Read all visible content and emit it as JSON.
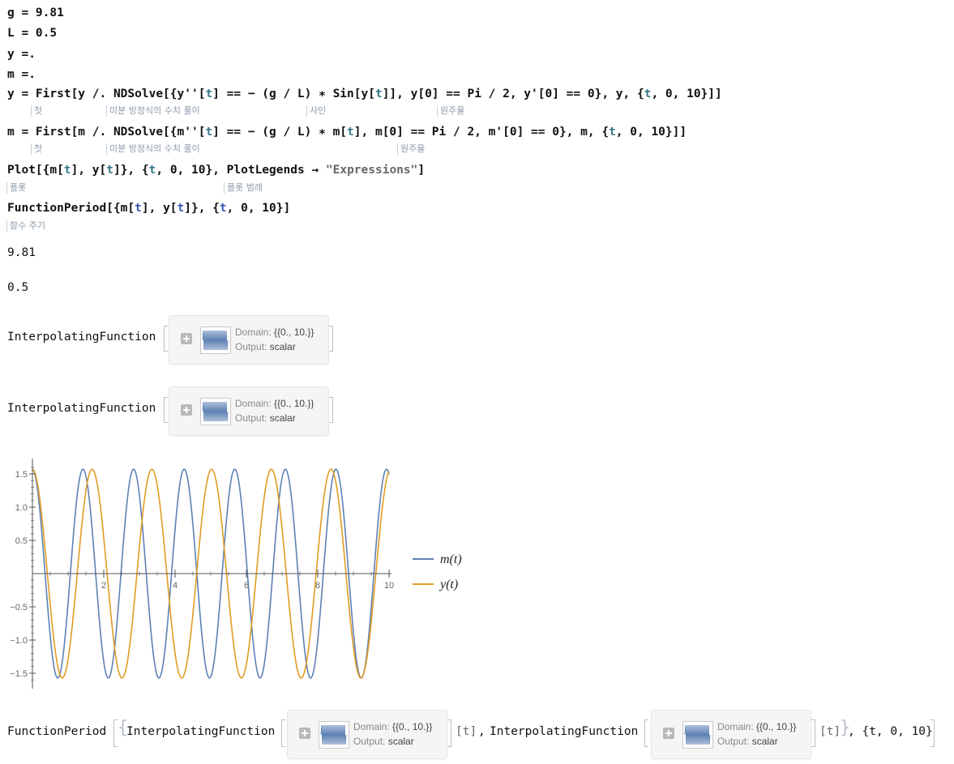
{
  "inputs": {
    "line1": "g = 9.81",
    "line2": "L = 0.5",
    "line3": "y =.",
    "line4": "m =.",
    "line5": {
      "p1": "y = First[y /. NDSolve[{y''[",
      "t1": "t",
      "p2": "] == − (g / L) ∗ Sin[y[",
      "t2": "t",
      "p3": "]], y[0] == Pi / 2, y'[0] == 0}, y, {",
      "t3": "t",
      "p4": ", 0, 10}]]"
    },
    "line6": {
      "p1": "m = First[m /. NDSolve[{m''[",
      "t1": "t",
      "p2": "] == − (g / L) ∗ m[",
      "t2": "t",
      "p3": "], m[0] == Pi / 2, m'[0] == 0}, m, {",
      "t3": "t",
      "p4": ", 0, 10}]]"
    },
    "line7": {
      "p1": "Plot[{m[",
      "t1": "t",
      "p2": "], y[",
      "t2": "t",
      "p3": "]}, {",
      "t3": "t",
      "p4": ", 0, 10}, PlotLegends → ",
      "str": "\"Expressions\"",
      "p5": "]"
    },
    "line8": {
      "p1": "FunctionPeriod[{m[",
      "t1": "t",
      "p2": "], y[",
      "t2": "t",
      "p3": "]}, {",
      "t3": "t",
      "p4": ", 0, 10}]"
    }
  },
  "hints": {
    "first": "첫",
    "ndsolve": "미분 방정식의 수치 풀이",
    "sine": "사인",
    "pi": "원주율",
    "plot": "플롯",
    "legend": "플롯 범례",
    "fperiod": "함수 주기"
  },
  "outputs": {
    "o1": "9.81",
    "o2": "0.5",
    "interp_label": "InterpolatingFunction",
    "domain_key": "Domain:",
    "domain_val": "{{0., 10.}}",
    "output_key": "Output:",
    "output_val": "scalar",
    "fp": {
      "head": "FunctionPeriod",
      "t_arg": "[t]",
      "comma": ",",
      "range": ", {t, 0, 10}"
    }
  },
  "chart_data": {
    "type": "line",
    "title": "",
    "xlabel": "",
    "ylabel": "",
    "xlim": [
      0,
      10
    ],
    "ylim": [
      -1.7,
      1.7
    ],
    "x_ticks": [
      "2",
      "4",
      "6",
      "8",
      "10"
    ],
    "y_ticks": [
      "1.5",
      "1.0",
      "0.5",
      "−0.5",
      "−1.0",
      "−1.5"
    ],
    "y_tick_values": [
      1.5,
      1.0,
      0.5,
      -0.5,
      -1.0,
      -1.5
    ],
    "x_tick_values": [
      2,
      4,
      6,
      8,
      10
    ],
    "grid": false,
    "legend_position": "right",
    "series": [
      {
        "name": "m(t)",
        "label_base": "m",
        "color": "#5e81b5",
        "amplitude": 1.5708,
        "period": 1.4185,
        "kind": "cosine"
      },
      {
        "name": "y(t)",
        "label_base": "y",
        "color": "#e19c24",
        "amplitude": 1.5708,
        "period": 1.6747,
        "kind": "cosine"
      }
    ]
  },
  "colors": {
    "m_series": "#5e81b5",
    "y_series": "#e19c24",
    "axis": "#555555",
    "hint": "#8c9bab",
    "symbol": "#3b5bb5"
  }
}
